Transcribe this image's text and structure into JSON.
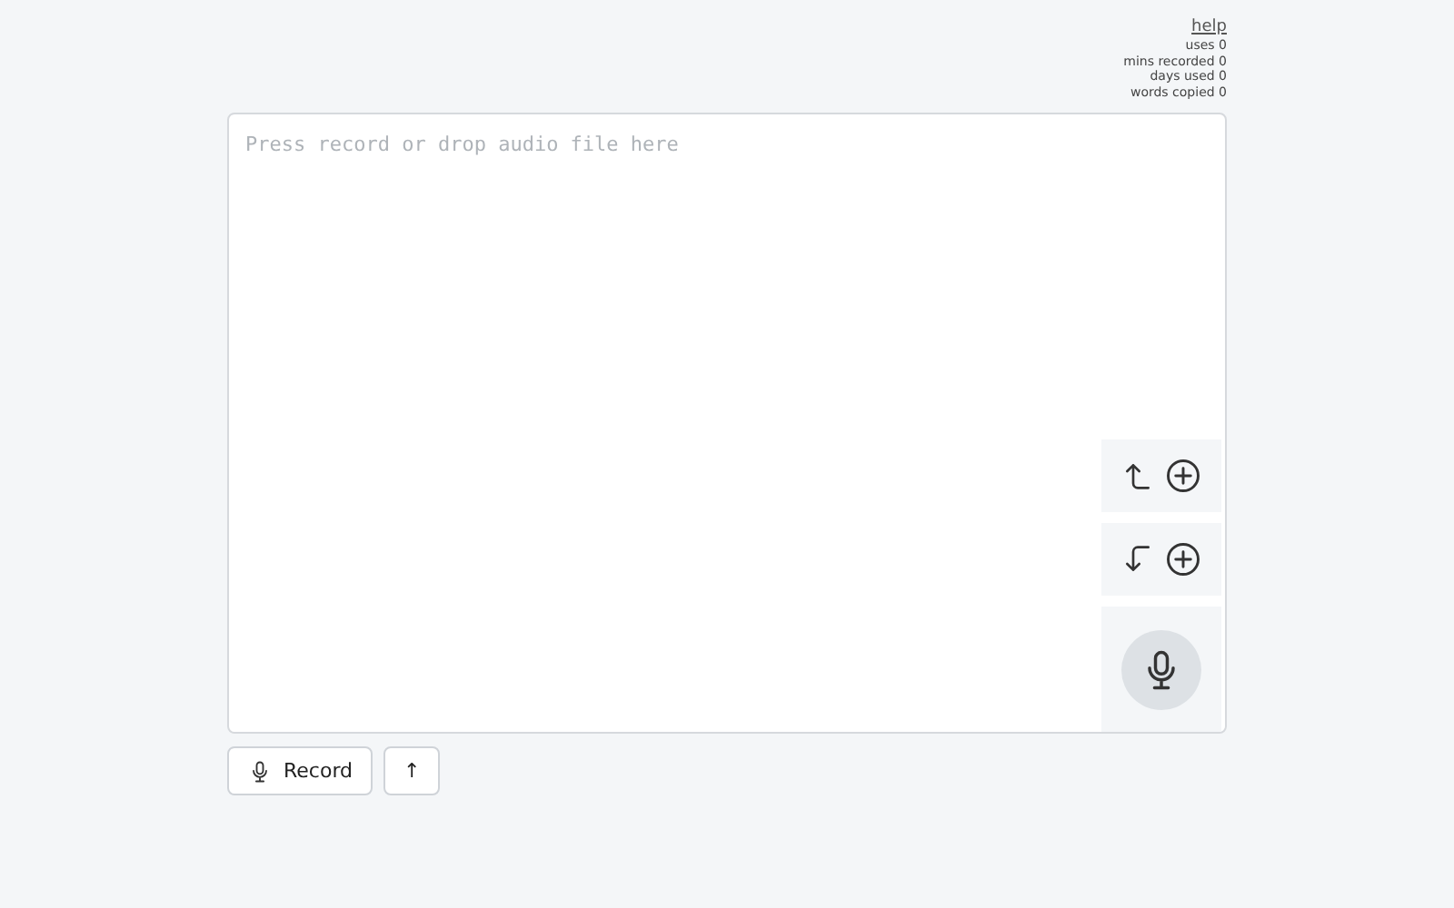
{
  "header": {
    "help_link": "help",
    "stats": [
      {
        "label": "uses",
        "value": "0"
      },
      {
        "label": "mins recorded",
        "value": "0"
      },
      {
        "label": "days used",
        "value": "0"
      },
      {
        "label": "words copied",
        "value": "0"
      }
    ]
  },
  "editor": {
    "placeholder": "Press record or drop audio file here",
    "side_buttons": [
      {
        "kind": "insert-above"
      },
      {
        "kind": "insert-below"
      },
      {
        "kind": "mic"
      }
    ]
  },
  "toolbar": {
    "buttons": [
      {
        "kind": "record",
        "label": "Record"
      },
      {
        "kind": "upload",
        "label": "↑"
      }
    ]
  }
}
